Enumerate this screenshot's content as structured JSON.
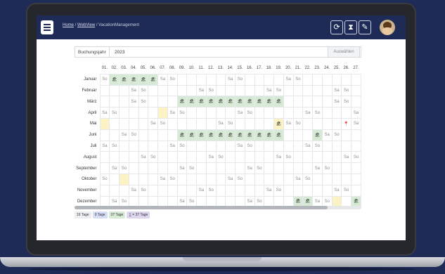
{
  "breadcrumb": {
    "home": "Home",
    "webview": "WebView",
    "current": "VacationManagement"
  },
  "toolbar": {
    "refresh_icon": "⟳",
    "hourglass_icon": "⧗",
    "edit_icon": "✎"
  },
  "booking": {
    "label": "Buchungsjahr",
    "year": "2023",
    "choose_label": "Auswählen"
  },
  "days": [
    "01.",
    "02.",
    "03.",
    "04.",
    "05.",
    "06.",
    "07.",
    "08.",
    "09.",
    "10.",
    "11.",
    "12.",
    "13.",
    "14.",
    "15.",
    "16.",
    "17.",
    "18.",
    "19.",
    "20.",
    "21.",
    "22.",
    "23.",
    "24.",
    "25.",
    "26.",
    "27."
  ],
  "months": [
    {
      "name": "Januar",
      "cells": [
        "So",
        "🏖",
        "🏖",
        "🏖",
        "🏖",
        "🏖",
        "Sa",
        "So",
        "",
        "",
        "",
        "",
        "",
        "Sa",
        "So",
        "",
        "",
        "",
        "",
        "Sa",
        "So",
        "",
        "",
        "",
        "",
        "",
        ""
      ]
    },
    {
      "name": "Februar",
      "cells": [
        "",
        "",
        "",
        "Sa",
        "So",
        "",
        "",
        "",
        "",
        "",
        "Sa",
        "So",
        "",
        "",
        "",
        "",
        "",
        "Sa",
        "So",
        "",
        "",
        "",
        "",
        "",
        "Sa",
        "So",
        ""
      ]
    },
    {
      "name": "März",
      "cells": [
        "",
        "",
        "",
        "Sa",
        "So",
        "",
        "",
        "",
        "🏖",
        "🏖",
        "🏖",
        "🏖",
        "🏖",
        "🏖",
        "🏖",
        "🏖",
        "🏖",
        "🏖",
        "🏖",
        "",
        "",
        "",
        "",
        "",
        "Sa",
        "So",
        ""
      ]
    },
    {
      "name": "April",
      "cells": [
        "Sa",
        "So",
        "",
        "",
        "",
        "",
        "",
        "Sa",
        "So",
        "",
        "",
        "",
        "",
        "",
        "Sa",
        "So",
        "",
        "",
        "",
        "",
        "",
        "Sa",
        "So",
        "",
        "",
        "",
        "Sa"
      ]
    },
    {
      "name": "Mai",
      "cells": [
        "",
        "",
        "",
        "",
        "",
        "Sa",
        "So",
        "",
        "",
        "",
        "",
        "",
        "Sa",
        "So",
        "",
        "",
        "",
        "",
        "🏖",
        "Sa",
        "So",
        "",
        "",
        "",
        "",
        "📍",
        "Sa"
      ]
    },
    {
      "name": "Juni",
      "cells": [
        "",
        "",
        "Sa",
        "So",
        "",
        "",
        "",
        "",
        "🏖",
        "🏖",
        "🏖",
        "🏖",
        "🏖",
        "🏖",
        "🏖",
        "🏖",
        "🏖",
        "🏖",
        "🏖",
        "",
        "",
        "",
        "🏖",
        "Sa",
        "So",
        "",
        ""
      ]
    },
    {
      "name": "Juli",
      "cells": [
        "Sa",
        "So",
        "",
        "",
        "",
        "",
        "",
        "Sa",
        "So",
        "",
        "",
        "",
        "",
        "",
        "Sa",
        "So",
        "",
        "",
        "",
        "",
        "",
        "Sa",
        "So",
        "",
        "",
        "",
        ""
      ]
    },
    {
      "name": "August",
      "cells": [
        "",
        "",
        "",
        "",
        "Sa",
        "So",
        "",
        "",
        "",
        "",
        "",
        "Sa",
        "So",
        "",
        "",
        "",
        "",
        "",
        "Sa",
        "So",
        "",
        "",
        "",
        "",
        "",
        "Sa",
        "So"
      ]
    },
    {
      "name": "September",
      "cells": [
        "",
        "Sa",
        "So",
        "",
        "",
        "",
        "",
        "",
        "Sa",
        "So",
        "",
        "",
        "",
        "",
        "",
        "Sa",
        "So",
        "",
        "",
        "",
        "",
        "",
        "Sa",
        "So",
        "",
        "",
        ""
      ]
    },
    {
      "name": "Oktober",
      "cells": [
        "So",
        "",
        "",
        "",
        "",
        "",
        "Sa",
        "So",
        "",
        "",
        "",
        "",
        "",
        "Sa",
        "So",
        "",
        "",
        "",
        "",
        "",
        "Sa",
        "So",
        "",
        "",
        "",
        "",
        ""
      ]
    },
    {
      "name": "November",
      "cells": [
        "",
        "",
        "",
        "Sa",
        "So",
        "",
        "",
        "",
        "",
        "",
        "Sa",
        "So",
        "",
        "",
        "",
        "",
        "",
        "Sa",
        "So",
        "",
        "",
        "",
        "",
        "",
        "Sa",
        "So",
        ""
      ]
    },
    {
      "name": "Dezember",
      "cells": [
        "",
        "Sa",
        "So",
        "",
        "",
        "",
        "",
        "",
        "Sa",
        "So",
        "",
        "",
        "",
        "",
        "",
        "Sa",
        "So",
        "",
        "",
        "",
        "🏖",
        "🏖",
        "Sa",
        "So",
        "",
        "",
        "🏖"
      ]
    }
  ],
  "legend": [
    {
      "label": "16 Tage",
      "color": "#eceef2"
    },
    {
      "label": "0 Tage",
      "color": "#d6def5"
    },
    {
      "label": "27 Tage",
      "color": "#d6ead6"
    },
    {
      "label": "∑ = 37 Tage",
      "color": "#dcd6ef"
    }
  ],
  "colors": {
    "appbar": "#1f2b57",
    "vacation": "#d6ead6",
    "holiday": "#fbf3c4"
  }
}
